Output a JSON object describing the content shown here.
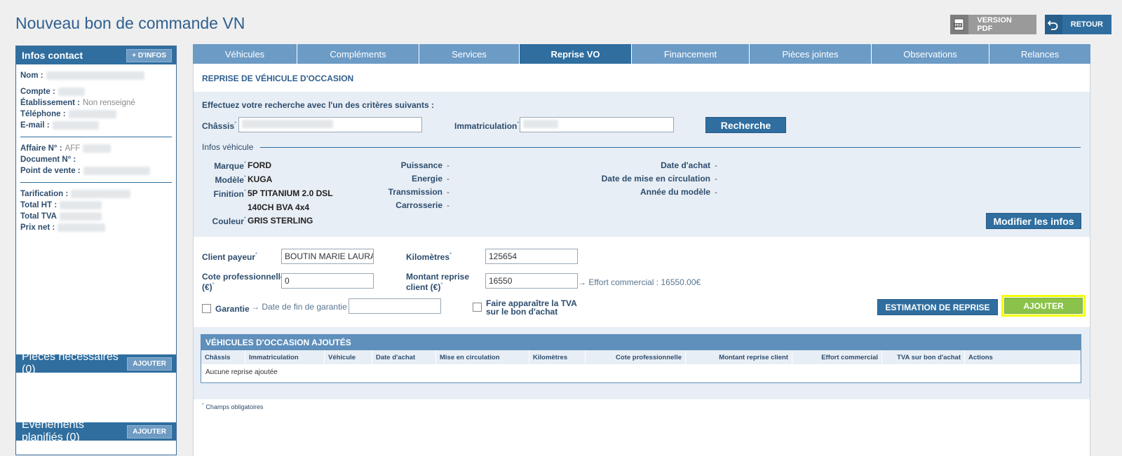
{
  "page_title": "Nouveau bon de commande VN",
  "header_buttons": {
    "pdf_label": "VERSION PDF",
    "retour_label": "RETOUR"
  },
  "sidebar": {
    "title": "Infos contact",
    "more_button": "+ D'INFOS",
    "fields": {
      "nom": "Nom :",
      "compte": "Compte :",
      "etablissement": "Établissement :",
      "etablissement_value": "Non renseigné",
      "telephone": "Téléphone :",
      "email": "E-mail :",
      "affaire": "Affaire N° :",
      "affaire_value": "AFF",
      "document": "Document N° :",
      "point_vente": "Point de vente :",
      "tarification": "Tarification :",
      "total_ht": "Total HT :",
      "total_tva": "Total TVA",
      "prix_net": "Prix net :"
    },
    "pieces_title": "Pièces nécessaires (0)",
    "evenements_title": "Événements planifiés (0)",
    "add_label": "AJOUTER"
  },
  "tabs": [
    {
      "label": "Véhicules"
    },
    {
      "label": "Compléments"
    },
    {
      "label": "Services"
    },
    {
      "label": "Reprise VO"
    },
    {
      "label": "Financement"
    },
    {
      "label": "Pièces jointes"
    },
    {
      "label": "Observations"
    },
    {
      "label": "Relances"
    }
  ],
  "section": {
    "title": "REPRISE DE VÉHICULE D'OCCASION",
    "search_intro": "Effectuez votre recherche avec l'un des critères suivants :",
    "chassis_label": "Châssis",
    "immat_label": "Immatriculation",
    "search_button": "Recherche",
    "infos_vehicule": "Infos véhicule"
  },
  "vehicle": {
    "marque_label": "Marque",
    "marque": "FORD",
    "modele_label": "Modèle",
    "modele": "KUGA",
    "finition_label": "Finition",
    "finition_1": "5P TITANIUM 2.0 DSL",
    "finition_2": "140CH BVA 4x4",
    "couleur_label": "Couleur",
    "couleur": "GRIS STERLING",
    "puissance_label": "Puissance",
    "energie_label": "Energie",
    "transmission_label": "Transmission",
    "carrosserie_label": "Carrosserie",
    "date_achat_label": "Date d'achat",
    "date_circulation_label": "Date de mise en circulation",
    "annee_label": "Année du modèle",
    "empty_value": "-",
    "modify_button": "Modifier les infos"
  },
  "form": {
    "client_payeur_label": "Client payeur",
    "client_payeur_value": "BOUTIN MARIE LAURAINE",
    "kilometres_label": "Kilomètres",
    "kilometres_value": "125654",
    "cote_label_1": "Cote professionnelle",
    "cote_label_2": "(€)",
    "cote_value": "0",
    "montant_label_1": "Montant reprise",
    "montant_label_2": "client (€)",
    "montant_value": "16550",
    "effort": "→ Effort commercial : 16550.00€",
    "garantie_label": "Garantie",
    "date_fin_garantie": "→ Date de fin de garantie",
    "tva_label_1": "Faire apparaître la TVA",
    "tva_label_2": "sur le bon d'achat",
    "estimation_button": "ESTIMATION DE REPRISE",
    "ajouter_button": "AJOUTER"
  },
  "table": {
    "title": "VÉHICULES D'OCCASION AJOUTÉS",
    "columns": [
      "Châssis",
      "Immatriculation",
      "Véhicule",
      "Date d'achat",
      "Mise en circulation",
      "Kilomètres",
      "Cote professionnelle",
      "Montant reprise client",
      "Effort commercial",
      "TVA sur bon d'achat",
      "Actions"
    ],
    "empty": "Aucune reprise ajoutée"
  },
  "required_note": "Champs obligatoires",
  "colors": {
    "primary": "#2f6e9f",
    "tab": "#6c9bc6",
    "accent_green": "#8bc34a",
    "highlight": "#f2ff00"
  }
}
